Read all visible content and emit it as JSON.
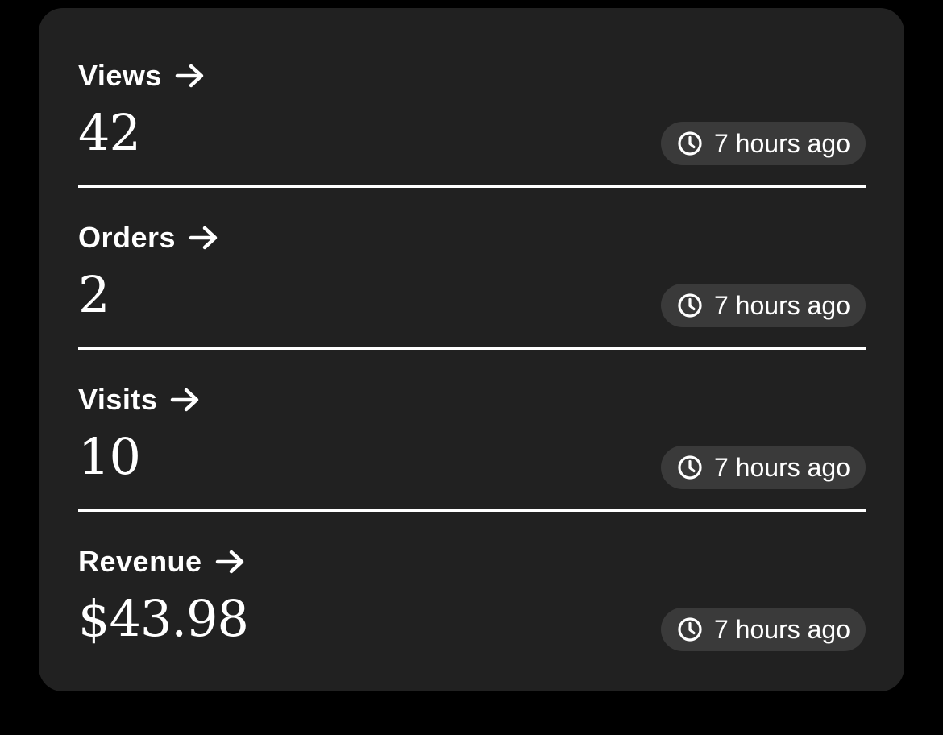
{
  "stats": [
    {
      "label": "Views",
      "value": "42",
      "updated": "7 hours ago"
    },
    {
      "label": "Orders",
      "value": "2",
      "updated": "7 hours ago"
    },
    {
      "label": "Visits",
      "value": "10",
      "updated": "7 hours ago"
    },
    {
      "label": "Revenue",
      "value": "$43.98",
      "updated": "7 hours ago"
    }
  ],
  "icons": {
    "title_arrow": "arrow-right-icon",
    "badge_clock": "clock-icon"
  },
  "colors": {
    "page_background": "#000000",
    "card_background": "#212121",
    "badge_background": "#3a3a3a",
    "text": "#ffffff",
    "divider": "#ffffff"
  }
}
